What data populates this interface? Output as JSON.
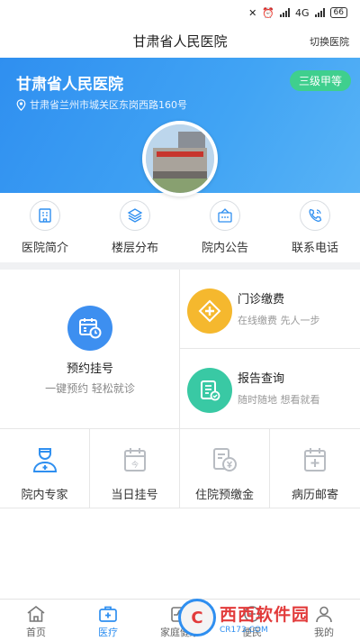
{
  "status": {
    "network": "4G",
    "battery": "66"
  },
  "nav": {
    "title": "甘肃省人民医院",
    "switch": "切换医院"
  },
  "hero": {
    "name": "甘肃省人民医院",
    "address": "甘肃省兰州市城关区东岗西路160号",
    "grade": "三级甲等"
  },
  "quick": [
    {
      "label": "医院简介",
      "icon": "hospital-info-icon"
    },
    {
      "label": "楼层分布",
      "icon": "layers-icon"
    },
    {
      "label": "院内公告",
      "icon": "announcement-icon"
    },
    {
      "label": "联系电话",
      "icon": "phone-icon"
    }
  ],
  "services": {
    "appointment": {
      "title": "预约挂号",
      "sub": "一键预约 轻松就诊",
      "icon": "calendar-clock-icon"
    },
    "payment": {
      "title": "门诊缴费",
      "sub": "在线缴费 先人一步",
      "icon": "plus-diamond-icon"
    },
    "report": {
      "title": "报告查询",
      "sub": "随时随地 想看就看",
      "icon": "report-icon"
    }
  },
  "tools": [
    {
      "label": "院内专家",
      "icon": "doctor-icon"
    },
    {
      "label": "当日挂号",
      "icon": "today-calendar-icon"
    },
    {
      "label": "住院预缴金",
      "icon": "deposit-icon"
    },
    {
      "label": "病历邮寄",
      "icon": "medical-record-icon"
    }
  ],
  "tabs": [
    {
      "label": "首页",
      "icon": "home-icon"
    },
    {
      "label": "医疗",
      "icon": "medical-kit-icon",
      "active": true
    },
    {
      "label": "家庭健康",
      "icon": "family-health-icon"
    },
    {
      "label": "便民",
      "icon": "service-icon"
    },
    {
      "label": "我的",
      "icon": "user-icon"
    }
  ],
  "watermark": {
    "main": "西西软件园",
    "sub": "CR173.COM",
    "logo": "C"
  },
  "colors": {
    "primary": "#2f8ff0",
    "grade": "#3fcf8e",
    "payment": "#f5b82e",
    "report": "#39c9a4"
  }
}
